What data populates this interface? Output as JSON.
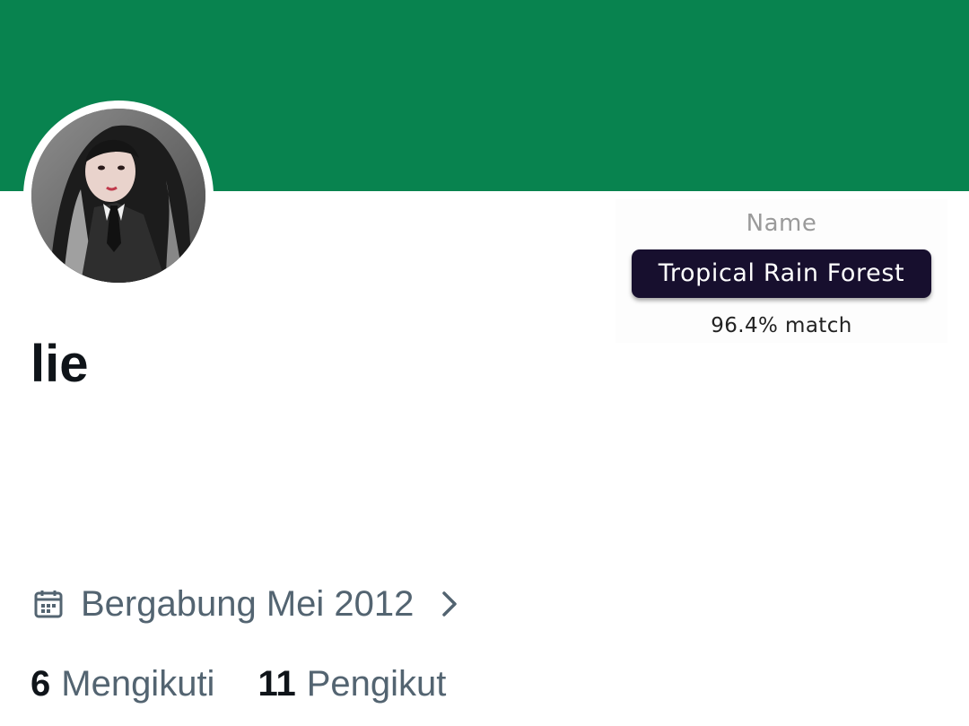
{
  "theme": {
    "banner_color": "#08834f",
    "pill_color": "#170f2e",
    "text_primary": "#0f1419",
    "text_secondary": "#536471"
  },
  "profile": {
    "display_name": "lie",
    "avatar_icon": "profile-photo"
  },
  "color_match": {
    "label": "Name",
    "color_name": "Tropical Rain Forest",
    "match_text": "96.4% match"
  },
  "joined": {
    "icon": "calendar-icon",
    "text": "Bergabung Mei 2012",
    "chevron": "chevron-right-icon"
  },
  "stats": {
    "following_count": "6",
    "following_label": "Mengikuti",
    "followers_count": "11",
    "followers_label": "Pengikut"
  }
}
